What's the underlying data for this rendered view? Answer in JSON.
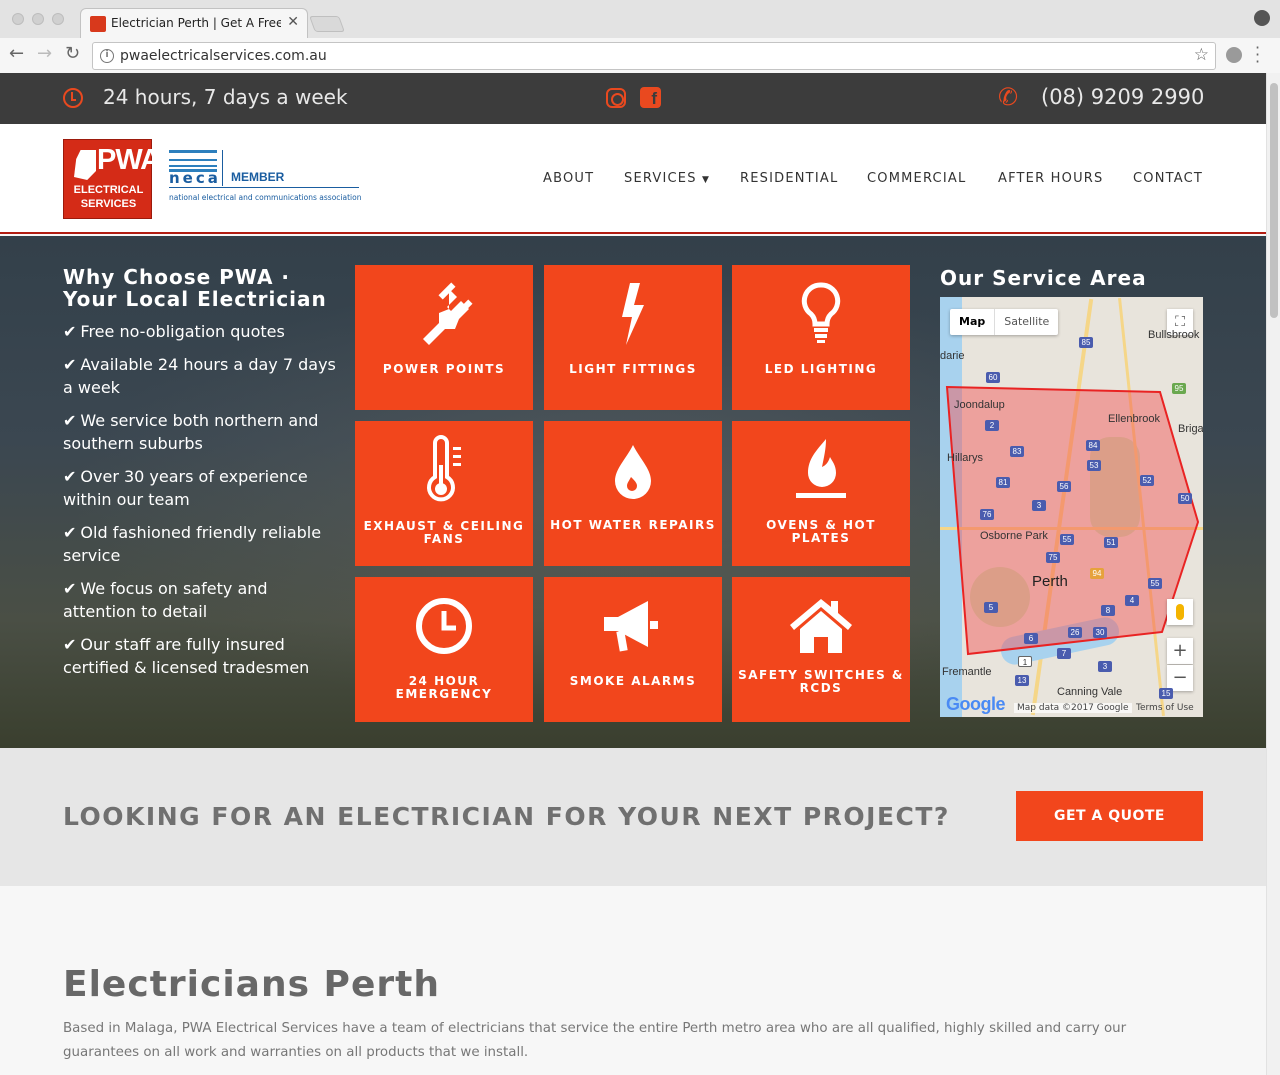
{
  "browser": {
    "tab_title": "Electrician Perth | Get A Free Q",
    "url": "pwaelectricalservices.com.au"
  },
  "topbar": {
    "hours": "24 hours, 7 days a week",
    "phone": "(08) 9209 2990",
    "icons": [
      "clock-icon",
      "instagram-icon",
      "facebook-icon",
      "phone-icon"
    ]
  },
  "header": {
    "logo": {
      "letters": "PWA",
      "line1": "ELECTRICAL",
      "line2": "SERVICES"
    },
    "neca": {
      "word": "neca",
      "member": "MEMBER",
      "tagline": "national electrical and communications association"
    },
    "nav": [
      "ABOUT",
      "SERVICES",
      "RESIDENTIAL",
      "COMMERCIAL",
      "AFTER HOURS",
      "CONTACT"
    ]
  },
  "hero": {
    "why_title": "Why Choose PWA · Your Local Electrician",
    "why_items": [
      "Free no-obligation quotes",
      "Available 24 hours a day 7 days a week",
      "We service both northern and southern suburbs",
      "Over 30 years of experience within our team",
      "Old fashioned friendly reliable service",
      "We focus on safety and attention to detail",
      "Our staff are fully insured certified & licensed tradesmen"
    ],
    "tiles": [
      {
        "label": "POWER POINTS",
        "icon": "plug-icon"
      },
      {
        "label": "LIGHT FITTINGS",
        "icon": "lightning-icon"
      },
      {
        "label": "LED LIGHTING",
        "icon": "lightbulb-icon"
      },
      {
        "label": "EXHAUST & CEILING FANS",
        "icon": "thermometer-icon"
      },
      {
        "label": "HOT WATER REPAIRS",
        "icon": "water-drop-icon"
      },
      {
        "label": "OVENS & HOT PLATES",
        "icon": "flame-icon"
      },
      {
        "label": "24 HOUR EMERGENCY",
        "icon": "clock-icon"
      },
      {
        "label": "SMOKE ALARMS",
        "icon": "megaphone-icon"
      },
      {
        "label": "SAFETY SWITCHES & RCDS",
        "icon": "house-icon"
      }
    ],
    "area_title": "Our Service Area",
    "map": {
      "type_map": "Map",
      "type_satellite": "Satellite",
      "labels": [
        "Bullsbrook",
        "darie",
        "Joondalup",
        "Ellenbrook",
        "Briga",
        "Hillarys",
        "Osborne Park",
        "Perth",
        "Fremantle",
        "Canning Vale"
      ],
      "shields": [
        "85",
        "60",
        "95",
        "2",
        "84",
        "83",
        "53",
        "81",
        "56",
        "52",
        "50",
        "3",
        "76",
        "55",
        "51",
        "75",
        "94",
        "55",
        "4",
        "5",
        "8",
        "26",
        "30",
        "6",
        "7",
        "1",
        "3",
        "13",
        "15"
      ],
      "google": "Google",
      "attribution": "Map data ©2017 Google",
      "terms": "Terms of Use"
    }
  },
  "cta": {
    "text": "LOOKING FOR AN ELECTRICIAN FOR YOUR NEXT PROJECT?",
    "button": "GET A QUOTE"
  },
  "content": {
    "heading": "Electricians Perth",
    "paragraph": "Based in Malaga, PWA Electrical Services have a team of electricians that service the entire Perth metro area who are all qualified, highly skilled and carry our guarantees on all work and warranties on all products that we install."
  },
  "colors": {
    "accent": "#f2461c",
    "topbar": "#3c3c3c",
    "header_border": "#b21d12"
  }
}
